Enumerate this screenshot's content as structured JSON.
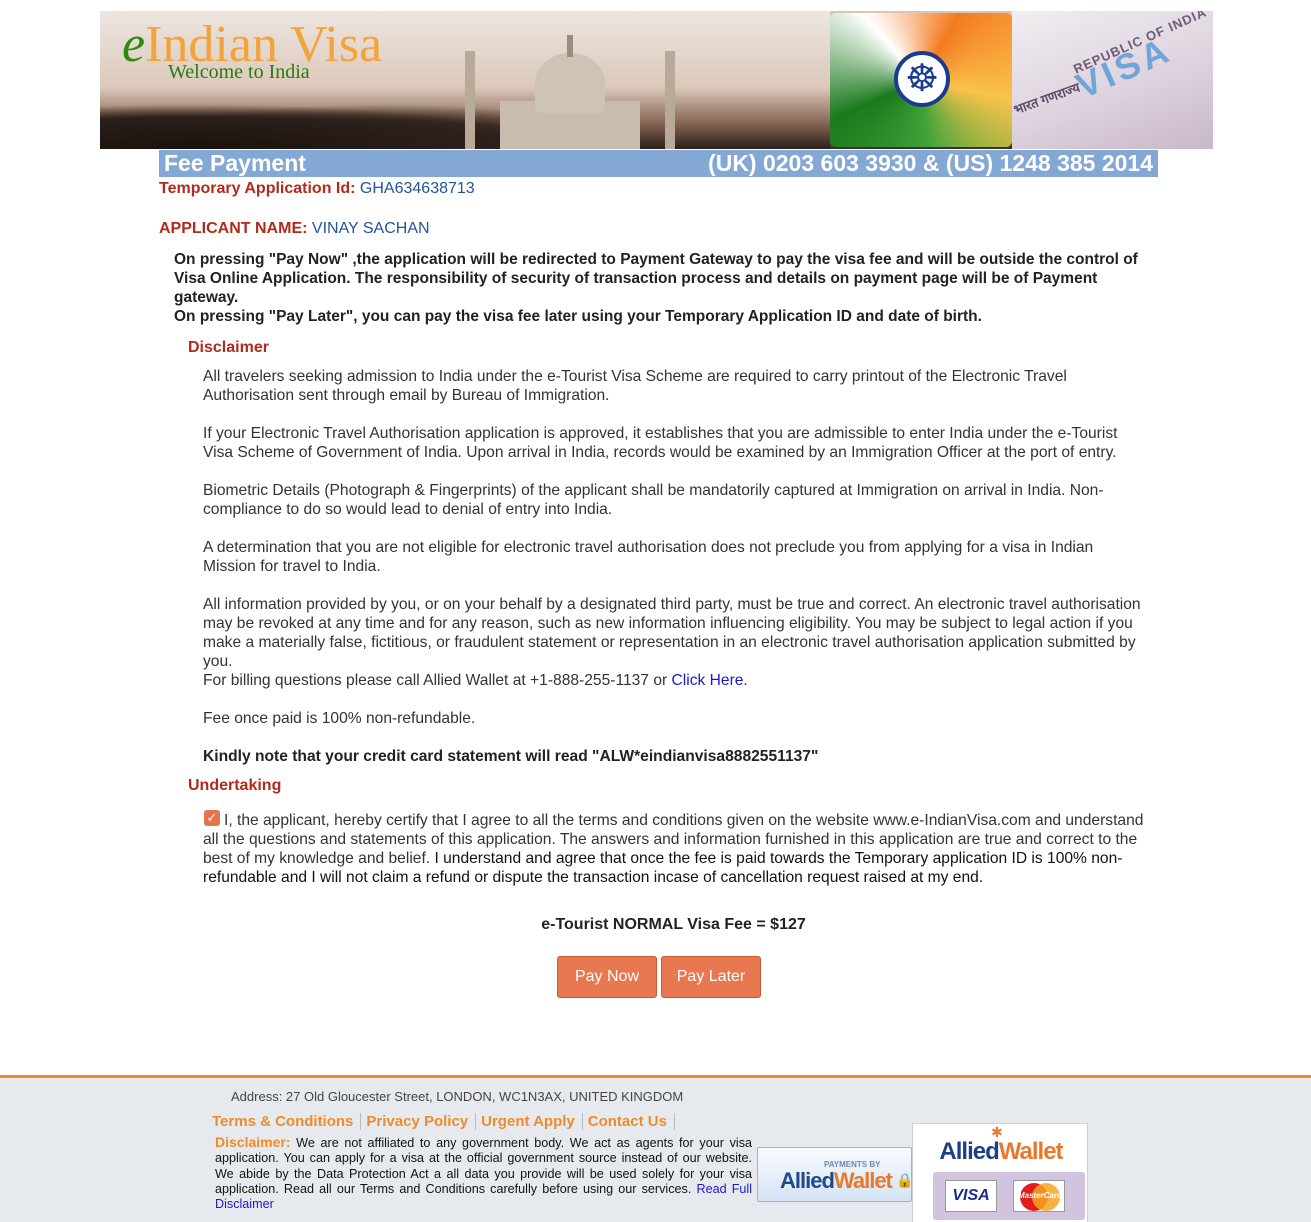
{
  "header": {
    "brand_e": "e",
    "brand_rest": "Indian Visa",
    "tagline": "Welcome to India",
    "passport_stamp": "REPUBLIC OF INDIA",
    "passport_visa": "VISA",
    "passport_hindi": "भारत गणराज्य",
    "chakra_glyph": "☸"
  },
  "titlebar": {
    "title": "Fee Payment",
    "phones": "(UK) 0203 603 3930 & (US) 1248 385 2014"
  },
  "application": {
    "id_label": "Temporary Application Id:",
    "id_value": "GHA634638713",
    "name_label": "APPLICANT NAME:",
    "name_value": "VINAY SACHAN"
  },
  "notices": {
    "pay_now": "On pressing \"Pay Now\" ,the application will be redirected to Payment Gateway to pay the visa fee and will be outside the control of Visa Online Application. The responsibility of security of transaction process and details on payment page will be of Payment gateway.",
    "pay_later": "On pressing \"Pay Later\", you can pay the visa fee later using your Temporary Application ID and date of birth."
  },
  "disclaimer": {
    "heading": "Disclaimer",
    "p1": "All travelers seeking admission to India under the e-Tourist Visa Scheme are required to carry printout of the Electronic Travel Authorisation sent through email by Bureau of Immigration.",
    "p2": "If your Electronic Travel Authorisation application is approved, it establishes that you are admissible to enter India under the e-Tourist Visa Scheme of Government of India. Upon arrival in India, records would be examined by an Immigration Officer at the port of entry.",
    "p3": "Biometric Details (Photograph & Fingerprints) of the applicant shall be mandatorily captured at Immigration on arrival in India. Non-compliance to do so would lead to denial of entry into India.",
    "p4": "A determination that you are not eligible for electronic travel authorisation does not preclude you from applying for a visa in Indian Mission for travel to India.",
    "p5": "All information provided by you, or on your behalf by a designated third party, must be true and correct. An electronic travel authorisation may be revoked at any time and for any reason, such as new information influencing eligibility. You may be subject to legal action if you make a materially false, fictitious, or fraudulent statement or representation in an electronic travel authorisation application submitted by you.",
    "billing_text": "For billing questions please call Allied Wallet at +1-888-255-1137 or ",
    "billing_link": "Click Here.",
    "refund": "Fee once paid is 100% non-refundable.",
    "statement": "Kindly note that your credit card statement will read \"ALW*eindianvisa8882551137\""
  },
  "undertaking": {
    "heading": "Undertaking",
    "checked": true,
    "check_glyph": "✓",
    "text_part1": "I, the applicant, hereby certify that I agree to all the terms and conditions given on the website www.e-IndianVisa.com and understand all the questions and statements of this application. The answers and information furnished in this application are true and correct to the best of my knowledge and belief. ",
    "text_part2": "I understand and agree that once the fee is paid towards the Temporary application ID is 100% non-refundable and I will not claim a refund or dispute the transaction incase of cancellation request raised at my end."
  },
  "fee": {
    "label": "e-Tourist NORMAL Visa Fee = $127"
  },
  "buttons": {
    "pay_now": "Pay Now",
    "pay_later": "Pay Later"
  },
  "footer": {
    "address": "Address: 27 Old Gloucester Street, LONDON, WC1N3AX, UNITED KINGDOM",
    "links": [
      "Terms & Conditions",
      "Privacy Policy",
      "Urgent Apply",
      "Contact Us"
    ],
    "disclaimer_label": "Disclaimer:",
    "disclaimer_text": " We are not affiliated to any government body. We act as agents for your visa application. You can apply for a visa at the official government source instead of our website. We abide by the Data Protection Act a all data you provide will be used solely for your visa application. Read all our Terms and Conditions carefully before using our services. ",
    "disclaimer_link": "Read Full Disclaimer",
    "badge_small": "PAYMENTS BY",
    "badge_name_a": "Allied",
    "badge_name_b": "Wallet",
    "card_visa": "VISA",
    "card_mc": "MasterCard"
  },
  "colors": {
    "accent_orange": "#e8784f",
    "title_blue": "#83a8d3",
    "label_red": "#b22a1b",
    "footer_orange": "#ef8b2c"
  }
}
